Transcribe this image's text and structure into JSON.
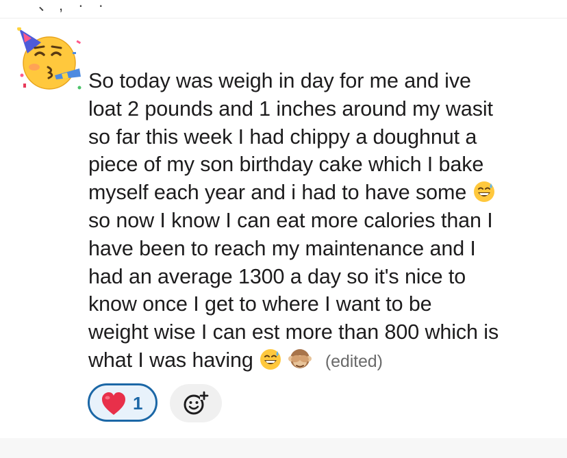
{
  "top_strip": {
    "partial_text": "、, · ·"
  },
  "message": {
    "line1": "So today was weigh in day for me and ive",
    "line2": "loat 2 pounds and 1  inches around my wasit",
    "line3": "so far this week I had chippy a doughnut a",
    "line4": "piece of my son birthday cake which I bake",
    "line5": "myself each year  and i had to have some",
    "line6": "so now I know I can eat more calories than I",
    "line7": "have been to reach my maintenance and I",
    "line8": "had an average 1300 a day so it's nice to",
    "line9": "know once I get to where I want to be",
    "line10": "weight wise I can est more than 800 which is",
    "line11": "what I was having",
    "edited": "(edited)"
  },
  "reaction": {
    "emoji": "heart-icon",
    "count": "1"
  },
  "add_reaction": {
    "icon": "add-reaction-icon"
  },
  "colors": {
    "accent": "#1b67a6",
    "text": "#1d1c1d",
    "muted": "#6a6a6a",
    "pill_bg": "#e8f2fb"
  }
}
